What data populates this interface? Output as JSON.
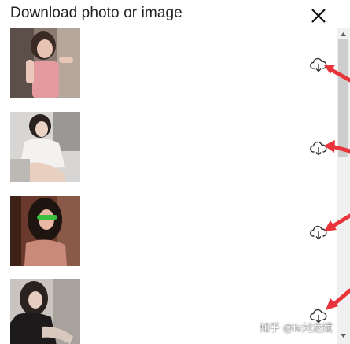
{
  "dialog": {
    "title": "Download photo or image",
    "close_icon": "close-icon"
  },
  "images": [
    {
      "thumb_name": "photo-thumbnail-1",
      "download_icon": "cloud-download-icon"
    },
    {
      "thumb_name": "photo-thumbnail-2",
      "download_icon": "cloud-download-icon"
    },
    {
      "thumb_name": "photo-thumbnail-3",
      "download_icon": "cloud-download-icon"
    },
    {
      "thumb_name": "photo-thumbnail-4",
      "download_icon": "cloud-download-icon"
    }
  ],
  "annotation": {
    "arrow_color": "#e8343a"
  },
  "watermark": "知乎 @fe刘龙斌"
}
